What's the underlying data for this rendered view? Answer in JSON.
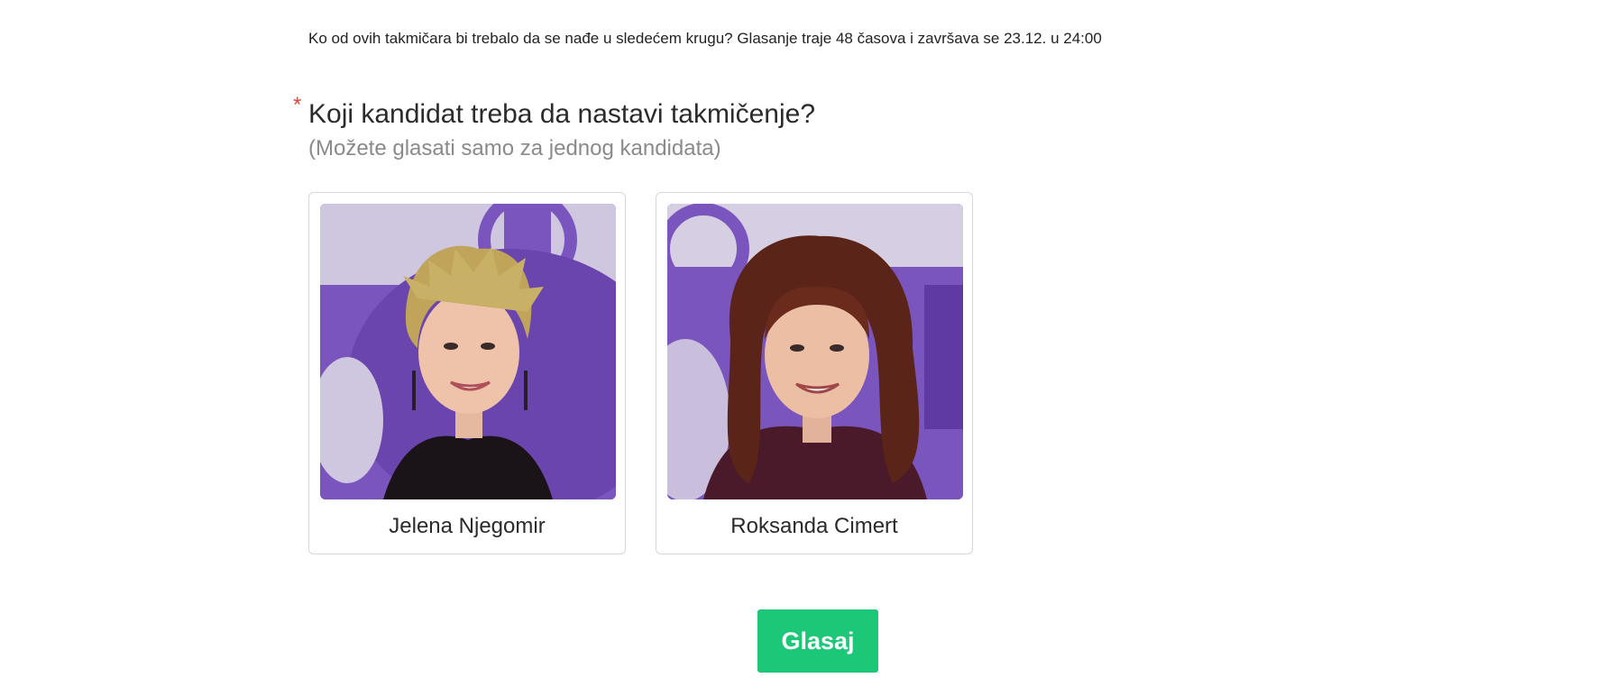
{
  "intro_text": "Ko od ovih takmičara bi trebalo da se nađe u sledećem krugu? Glasanje traje 48 časova i završava se 23.12. u 24:00",
  "question": {
    "required_marker": "*",
    "title": "Koji kandidat treba da nastavi takmičenje?",
    "hint": "(Možete glasati samo za jednog kandidata)"
  },
  "candidates": [
    {
      "name": "Jelena Njegomir"
    },
    {
      "name": "Roksanda Cimert"
    }
  ],
  "vote_button": {
    "label": "Glasaj"
  },
  "colors": {
    "accent_button": "#1cc878",
    "required_star": "#e0463a",
    "backdrop_purple": "#6f4bb1"
  }
}
